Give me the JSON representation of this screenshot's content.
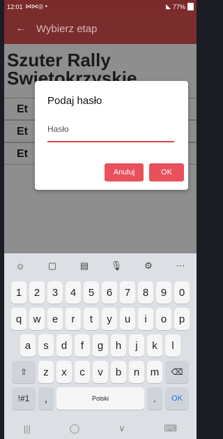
{
  "status": {
    "time": "12:01",
    "icons": "⋈⋈◎ •",
    "battery": "77%"
  },
  "appbar": {
    "title": "Wybierz etap",
    "back": "←"
  },
  "content": {
    "heading": "Szuter Rally Swietokrzyskie",
    "rows": [
      "Et",
      "Et",
      "Et"
    ]
  },
  "dialog": {
    "title": "Podaj hasło",
    "field_placeholder": "Hasło",
    "cancel_label": "Anuluj",
    "ok_label": "OK"
  },
  "keyboard": {
    "toolbar": [
      "☺",
      "▢",
      "▤",
      "🎙",
      "⚙",
      "⋯"
    ],
    "numbers": [
      "1",
      "2",
      "3",
      "4",
      "5",
      "6",
      "7",
      "8",
      "9",
      "0"
    ],
    "row1": [
      "q",
      "w",
      "e",
      "r",
      "t",
      "y",
      "u",
      "i",
      "o",
      "p"
    ],
    "row2": [
      "a",
      "s",
      "d",
      "f",
      "g",
      "h",
      "j",
      "k",
      "l"
    ],
    "row3": [
      "z",
      "x",
      "c",
      "v",
      "b",
      "n",
      "m"
    ],
    "shift": "⇧",
    "backspace": "⌫",
    "symbols": "!#1",
    "comma": ",",
    "space": "Polski",
    "period": ".",
    "ok": "OK"
  },
  "navbar": {
    "recent": "|||",
    "home": "◯",
    "back": "∨",
    "kbd": "⌨"
  }
}
